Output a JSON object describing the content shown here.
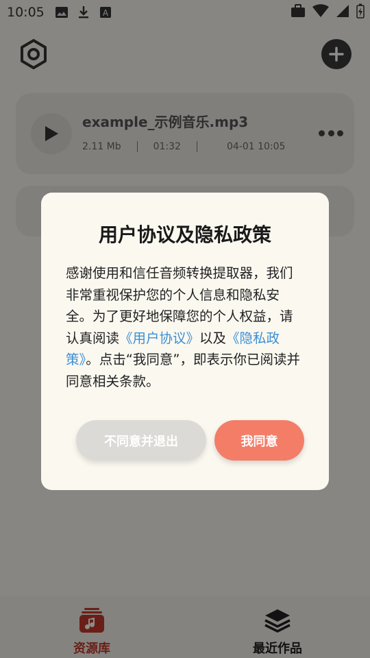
{
  "status_bar": {
    "time": "10:05",
    "left_icons": [
      "image-icon",
      "download-icon",
      "a-font-icon"
    ],
    "right_icons": [
      "briefcase-icon",
      "wifi-icon",
      "signal-icon",
      "battery-charging-icon"
    ]
  },
  "header": {
    "settings_icon": "hexagon-settings-icon",
    "add_icon": "plus-icon"
  },
  "track": {
    "title": "example_示例音乐.mp3",
    "size": "2.11 Mb",
    "duration": "01:32",
    "date": "04-01 10:05"
  },
  "dialog": {
    "title": "用户协议及隐私政策",
    "body_part1": "感谢使用和信任音频转换提取器，我们非常重视保护您的个人信息和隐私安全。为了更好地保障您的个人权益，请认真阅读",
    "link_user_agreement": "《用户协议》",
    "body_part2": "以及",
    "link_privacy": "《隐私政策》",
    "body_part3": "。点击“我同意”，即表示你已阅读并同意相关条款。",
    "decline_label": "不同意并退出",
    "agree_label": "我同意"
  },
  "bottom_nav": {
    "items": [
      {
        "label": "资源库",
        "icon": "music-library-icon",
        "active": true
      },
      {
        "label": "最近作品",
        "icon": "layers-icon",
        "active": false
      }
    ]
  },
  "colors": {
    "accent": "#f47d68",
    "nav_active": "#c0392b",
    "link": "#3b8fd6",
    "overlay": "rgba(0,0,0,0.45)"
  }
}
